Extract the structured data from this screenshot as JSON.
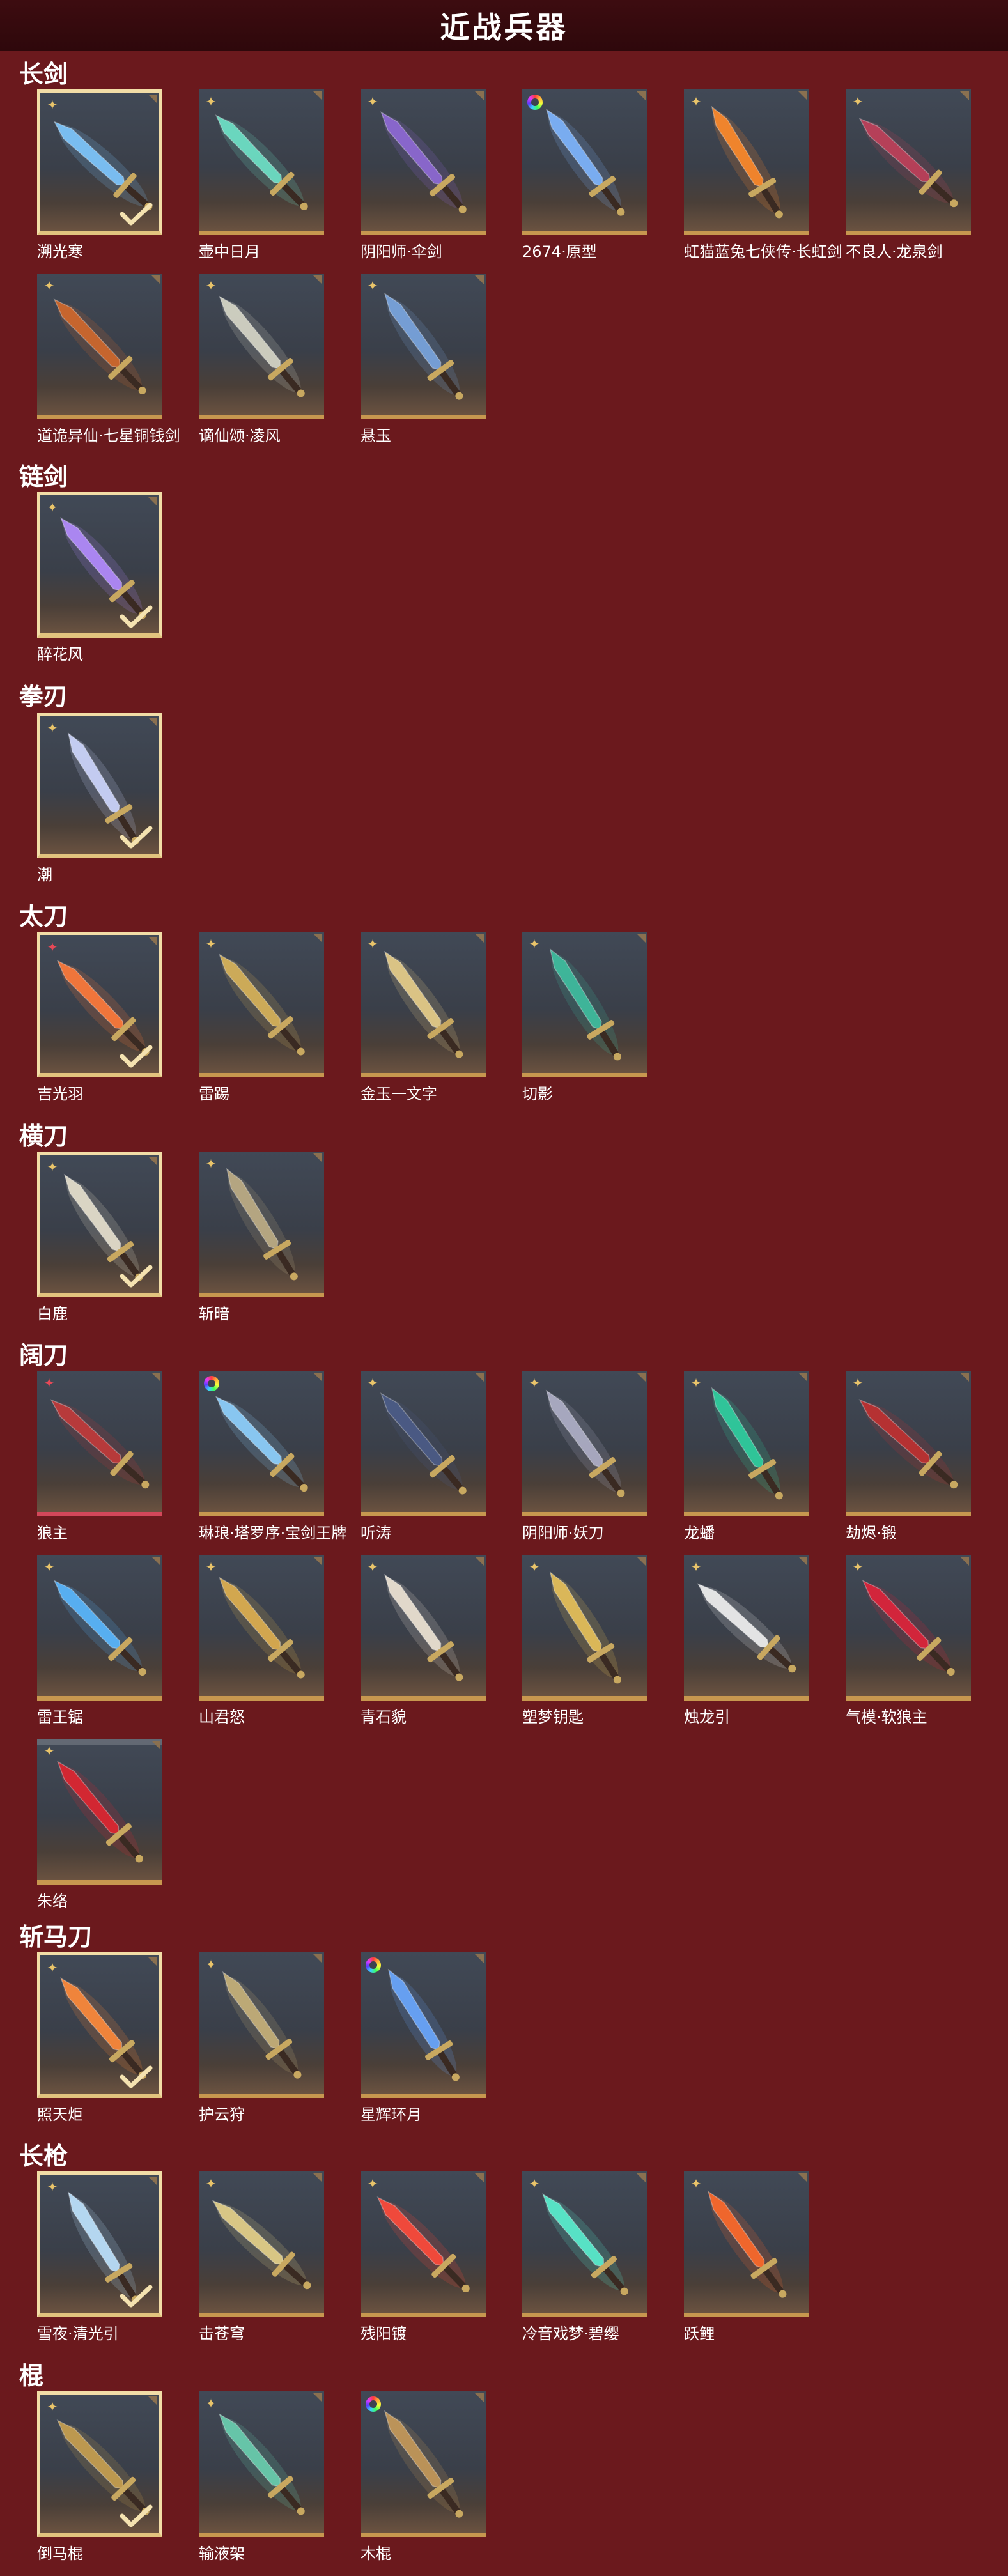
{
  "page": {
    "title": "近战兵器"
  },
  "colors": {
    "background": "#6b191d",
    "header": "#2e080b",
    "card_border": "#c7974f",
    "selected_border": "#f2dda7"
  },
  "sections": [
    {
      "title": "长剑",
      "items": [
        {
          "name": "溯光寒",
          "badge": "gold-star-icon",
          "selected": true,
          "accent": "#7fc8ff"
        },
        {
          "name": "壶中日月",
          "badge": "gold-star-icon",
          "selected": false,
          "accent": "#6fe3c8"
        },
        {
          "name": "阴阳师·伞剑",
          "badge": "gold-star-icon",
          "selected": false,
          "accent": "#8f6ad6"
        },
        {
          "name": "2674·原型",
          "badge": "rainbow-icon",
          "selected": false,
          "accent": "#7fb6ff"
        },
        {
          "name": "虹猫蓝兔七侠传·长虹剑",
          "badge": "gold-star-icon",
          "selected": false,
          "accent": "#ff8a2a"
        },
        {
          "name": "不良人·龙泉剑",
          "badge": "gold-star-icon",
          "selected": false,
          "accent": "#c0405a"
        },
        {
          "name": "道诡异仙·七星铜钱剑",
          "badge": "gold-star-icon",
          "selected": false,
          "accent": "#d2692c"
        },
        {
          "name": "谪仙颂·凌风",
          "badge": "gold-star-icon",
          "selected": false,
          "accent": "#d8d8c8"
        },
        {
          "name": "悬玉",
          "badge": "gold-star-icon",
          "selected": false,
          "accent": "#7aa6e0"
        }
      ]
    },
    {
      "title": "链剑",
      "items": [
        {
          "name": "醉花风",
          "badge": "gold-star-icon",
          "selected": true,
          "accent": "#b48cff"
        }
      ]
    },
    {
      "title": "拳刃",
      "items": [
        {
          "name": "潮",
          "badge": "gold-star-icon",
          "selected": true,
          "accent": "#cfd8ff"
        }
      ]
    },
    {
      "title": "太刀",
      "items": [
        {
          "name": "吉光羽",
          "badge": "red-star-icon",
          "selected": true,
          "accent": "#ff7a3a"
        },
        {
          "name": "雷踢",
          "badge": "gold-star-icon",
          "selected": false,
          "accent": "#d9b45a"
        },
        {
          "name": "金玉一文字",
          "badge": "gold-star-icon",
          "selected": false,
          "accent": "#e8cf8a"
        },
        {
          "name": "切影",
          "badge": "gold-star-icon",
          "selected": false,
          "accent": "#3fbfa0"
        }
      ]
    },
    {
      "title": "横刀",
      "items": [
        {
          "name": "白鹿",
          "badge": "gold-star-icon",
          "selected": true,
          "accent": "#e8e2cf"
        },
        {
          "name": "斩暗",
          "badge": "gold-star-icon",
          "selected": false,
          "accent": "#bfae86"
        }
      ]
    },
    {
      "title": "阔刀",
      "items": [
        {
          "name": "狼主",
          "badge": "red-star-icon",
          "selected": false,
          "pink": true,
          "accent": "#c23a3a"
        },
        {
          "name": "琳琅·塔罗序·宝剑王牌",
          "badge": "rainbow-icon",
          "selected": false,
          "accent": "#8fd2ff"
        },
        {
          "name": "听涛",
          "badge": "gold-star-icon",
          "selected": false,
          "accent": "#4c5c88"
        },
        {
          "name": "阴阳师·妖刀",
          "badge": "gold-star-icon",
          "selected": false,
          "accent": "#b0b0c8"
        },
        {
          "name": "龙蟠",
          "badge": "gold-star-icon",
          "selected": false,
          "accent": "#2fd0a0"
        },
        {
          "name": "劫烬·锻",
          "badge": "gold-star-icon",
          "selected": false,
          "accent": "#c03030"
        },
        {
          "name": "雷王锯",
          "badge": "gold-star-icon",
          "selected": false,
          "accent": "#5ab8ff"
        },
        {
          "name": "山君怒",
          "badge": "gold-star-icon",
          "selected": false,
          "accent": "#e0b050"
        },
        {
          "name": "青石貌",
          "badge": "gold-star-icon",
          "selected": false,
          "accent": "#f0e6d6"
        },
        {
          "name": "塑梦钥匙",
          "badge": "gold-star-icon",
          "selected": false,
          "accent": "#e8c25a"
        },
        {
          "name": "烛龙引",
          "badge": "gold-star-icon",
          "selected": false,
          "accent": "#f2f2f2"
        },
        {
          "name": "气模·软狼主",
          "badge": "gold-star-icon",
          "selected": false,
          "accent": "#e0233a"
        },
        {
          "name": "朱络",
          "badge": "gold-star-icon",
          "selected": false,
          "stack": true,
          "accent": "#e02530"
        }
      ]
    },
    {
      "title": "斩马刀",
      "items": [
        {
          "name": "照天炬",
          "badge": "gold-star-icon",
          "selected": true,
          "accent": "#ff8a3a"
        },
        {
          "name": "护云狩",
          "badge": "gold-star-icon",
          "selected": false,
          "accent": "#c8b27a"
        },
        {
          "name": "星辉环月",
          "badge": "rainbow-icon",
          "selected": false,
          "accent": "#6aa8ff"
        }
      ]
    },
    {
      "title": "长枪",
      "items": [
        {
          "name": "雪夜·清光引",
          "badge": "gold-star-icon",
          "selected": true,
          "accent": "#bfe4ff"
        },
        {
          "name": "击苍穹",
          "badge": "gold-star-icon",
          "selected": false,
          "accent": "#e6d28a"
        },
        {
          "name": "残阳镀",
          "badge": "gold-star-icon",
          "selected": false,
          "accent": "#ff4a3a"
        },
        {
          "name": "冷音戏梦·碧缨",
          "badge": "gold-star-icon",
          "selected": false,
          "accent": "#5af0d0"
        },
        {
          "name": "跃鲤",
          "badge": "gold-star-icon",
          "selected": false,
          "accent": "#ff6a2a"
        }
      ]
    },
    {
      "title": "棍",
      "items": [
        {
          "name": "倒马棍",
          "badge": "gold-star-icon",
          "selected": true,
          "accent": "#c8a050"
        },
        {
          "name": "输液架",
          "badge": "gold-star-icon",
          "selected": false,
          "accent": "#6ad0b0"
        },
        {
          "name": "木棍",
          "badge": "rainbow-icon",
          "selected": false,
          "accent": "#c69a5a"
        }
      ]
    }
  ]
}
